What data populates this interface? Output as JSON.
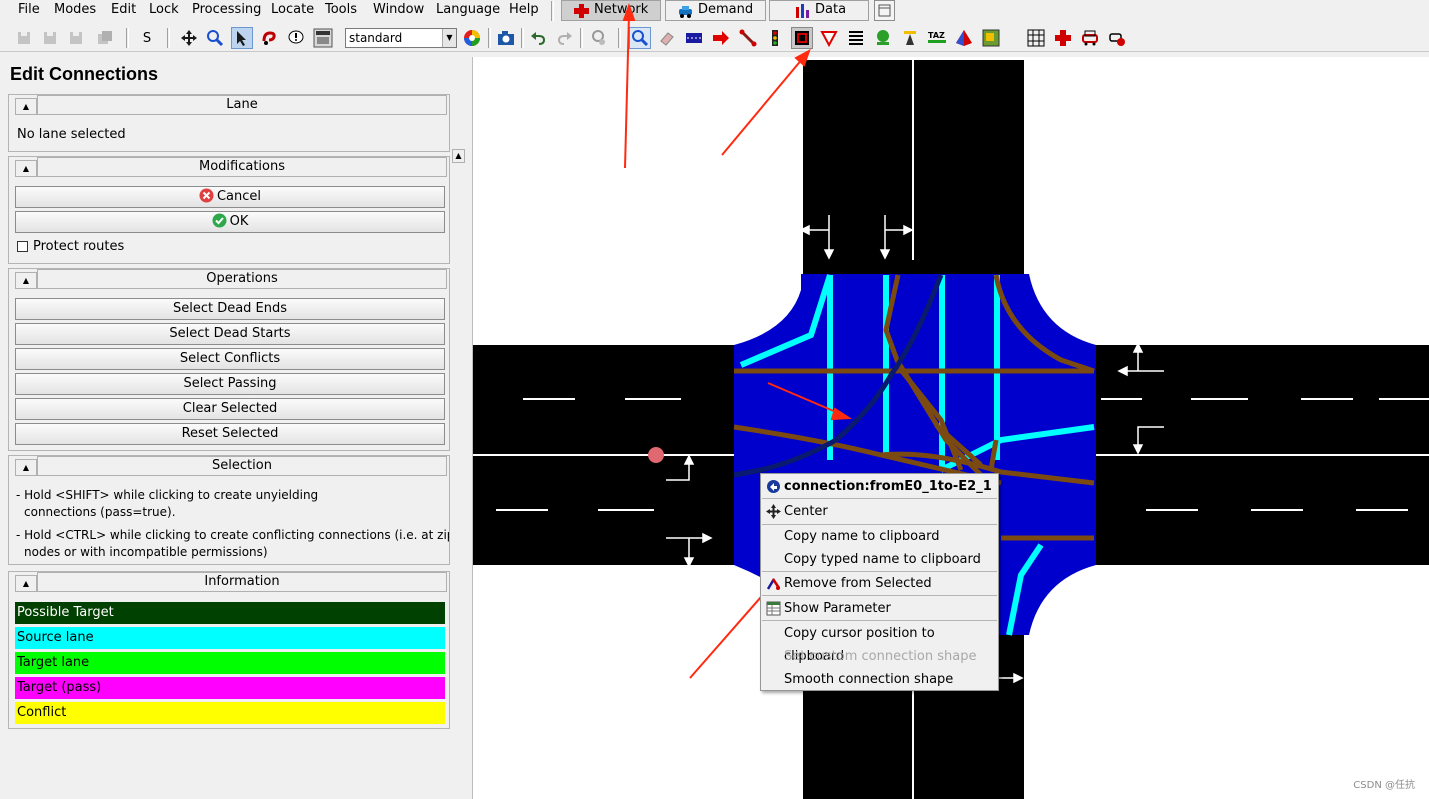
{
  "menu": [
    "File",
    "Modes",
    "Edit",
    "Lock",
    "Processing",
    "Locate",
    "Tools",
    "Window",
    "Language",
    "Help"
  ],
  "modes": {
    "network": "Network",
    "demand": "Demand",
    "data": "Data"
  },
  "toolbar": {
    "s_label": "S",
    "scheme": "standard"
  },
  "panel": {
    "title": "Edit Connections",
    "lane": {
      "title": "Lane",
      "text": "No lane selected"
    },
    "modifications": {
      "title": "Modifications",
      "cancel": "Cancel",
      "ok": "OK",
      "protect": "Protect routes"
    },
    "operations": {
      "title": "Operations",
      "buttons": [
        "Select Dead Ends",
        "Select Dead Starts",
        "Select Conflicts",
        "Select Passing",
        "Clear Selected",
        "Reset Selected"
      ]
    },
    "selection": {
      "title": "Selection",
      "line1": "- Hold <SHIFT> while clicking to create unyielding",
      "line2": "connections (pass=true).",
      "line3": "- Hold <CTRL> while clicking to create conflicting connections (i.e. at zipp",
      "line4": "nodes or with incompatible permissions)"
    },
    "information": {
      "title": "Information",
      "items": [
        {
          "label": "Possible Target",
          "color": "#004000",
          "text": "#ffffff"
        },
        {
          "label": "Source lane",
          "color": "#00ffff",
          "text": "#000000"
        },
        {
          "label": "Target lane",
          "color": "#00ff00",
          "text": "#000000"
        },
        {
          "label": "Target (pass)",
          "color": "#ff00ff",
          "text": "#000000"
        },
        {
          "label": "Conflict",
          "color": "#ffff00",
          "text": "#000000"
        }
      ]
    }
  },
  "context_menu": {
    "title": "connection:fromE0_1to-E2_1",
    "items": [
      "Center",
      "Copy name to clipboard",
      "Copy typed name to clipboard",
      "Remove from Selected",
      "Show Parameter",
      "Copy cursor position to clipboard",
      "Set custom connection shape",
      "Smooth connection shape"
    ]
  },
  "watermark": "CSDN @任抗",
  "colors": {
    "junction": "#0000cc",
    "source_lane": "#00ffff",
    "connection": "#7a4a10",
    "selected_connection": "#0a1a6e",
    "road": "#000000",
    "annotation": "#ff2a10"
  }
}
